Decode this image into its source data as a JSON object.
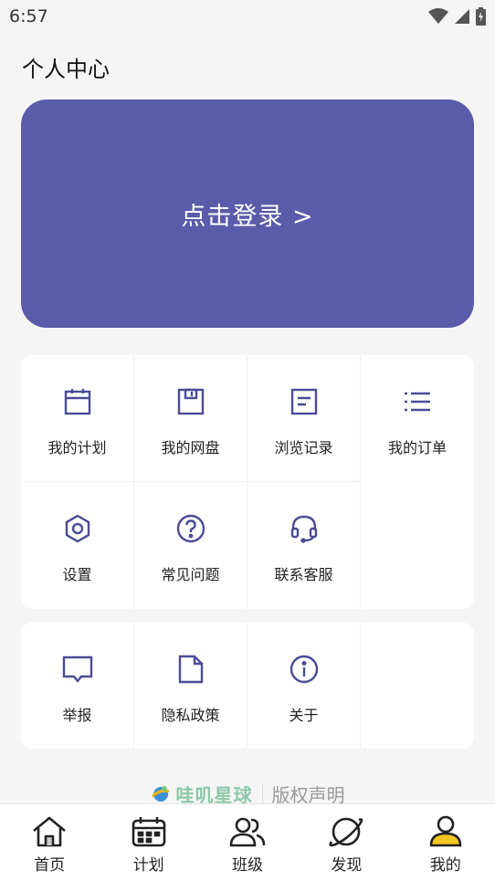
{
  "status": {
    "time": "6:57"
  },
  "header": {
    "title": "个人中心"
  },
  "login": {
    "label": "点击登录 >"
  },
  "menu_group_1": [
    {
      "label": "我的计划",
      "icon": "calendar-icon"
    },
    {
      "label": "我的网盘",
      "icon": "floppy-disk-icon"
    },
    {
      "label": "浏览记录",
      "icon": "document-icon"
    },
    {
      "label": "我的订单",
      "icon": "list-icon"
    },
    {
      "label": "设置",
      "icon": "settings-icon"
    },
    {
      "label": "常见问题",
      "icon": "question-icon"
    },
    {
      "label": "联系客服",
      "icon": "headset-icon"
    }
  ],
  "menu_group_2": [
    {
      "label": "举报",
      "icon": "report-bubble-icon"
    },
    {
      "label": "隐私政策",
      "icon": "file-icon"
    },
    {
      "label": "关于",
      "icon": "info-icon"
    }
  ],
  "footer": {
    "brand": "哇叽星球",
    "copyright": "版权声明"
  },
  "tabs": [
    {
      "label": "首页",
      "icon": "home-icon"
    },
    {
      "label": "计划",
      "icon": "calendar-icon"
    },
    {
      "label": "班级",
      "icon": "group-icon"
    },
    {
      "label": "发现",
      "icon": "planet-icon"
    },
    {
      "label": "我的",
      "icon": "profile-icon"
    }
  ],
  "colors": {
    "accent": "#5a5ba9",
    "icon": "#4a4c98",
    "background": "#f5f5f6"
  }
}
